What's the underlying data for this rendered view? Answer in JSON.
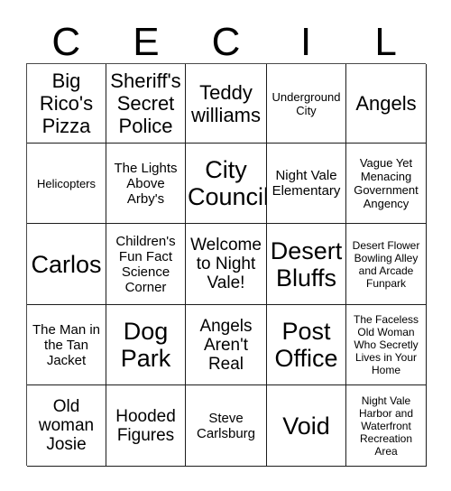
{
  "header": {
    "letters": [
      "C",
      "E",
      "C",
      "I",
      "L"
    ]
  },
  "grid": {
    "rows": [
      [
        {
          "text": "Big Rico's Pizza",
          "size": "lg"
        },
        {
          "text": "Sheriff's Secret Police",
          "size": "lg"
        },
        {
          "text": "Teddy williams",
          "size": "lg"
        },
        {
          "text": "Underground City",
          "size": "xs"
        },
        {
          "text": "Angels",
          "size": "lg"
        }
      ],
      [
        {
          "text": "Helicopters",
          "size": "xs"
        },
        {
          "text": "The Lights Above Arby's",
          "size": "sm"
        },
        {
          "text": "City Council",
          "size": "xl"
        },
        {
          "text": "Night Vale Elementary",
          "size": "sm"
        },
        {
          "text": "Vague Yet Menacing Government Angency",
          "size": "xs"
        }
      ],
      [
        {
          "text": "Carlos",
          "size": "xl"
        },
        {
          "text": "Children's Fun Fact Science Corner",
          "size": "sm"
        },
        {
          "text": "Welcome to Night Vale!",
          "size": "md"
        },
        {
          "text": "Desert Bluffs",
          "size": "xl"
        },
        {
          "text": "Desert Flower Bowling Alley and Arcade Funpark",
          "size": "xxs"
        }
      ],
      [
        {
          "text": "The Man in the Tan Jacket",
          "size": "sm"
        },
        {
          "text": "Dog Park",
          "size": "xl"
        },
        {
          "text": "Angels Aren't Real",
          "size": "md"
        },
        {
          "text": "Post Office",
          "size": "xl"
        },
        {
          "text": "The Faceless Old Woman Who Secretly Lives in Your Home",
          "size": "xxs"
        }
      ],
      [
        {
          "text": "Old woman Josie",
          "size": "md"
        },
        {
          "text": "Hooded Figures",
          "size": "md"
        },
        {
          "text": "Steve Carlsburg",
          "size": "sm"
        },
        {
          "text": "Void",
          "size": "xl"
        },
        {
          "text": "Night Vale Harbor and Waterfront Recreation Area",
          "size": "xxs"
        }
      ]
    ]
  },
  "colors": {
    "background": "#ffffff",
    "grid_line": "#1c1c1c",
    "text": "#000000"
  }
}
